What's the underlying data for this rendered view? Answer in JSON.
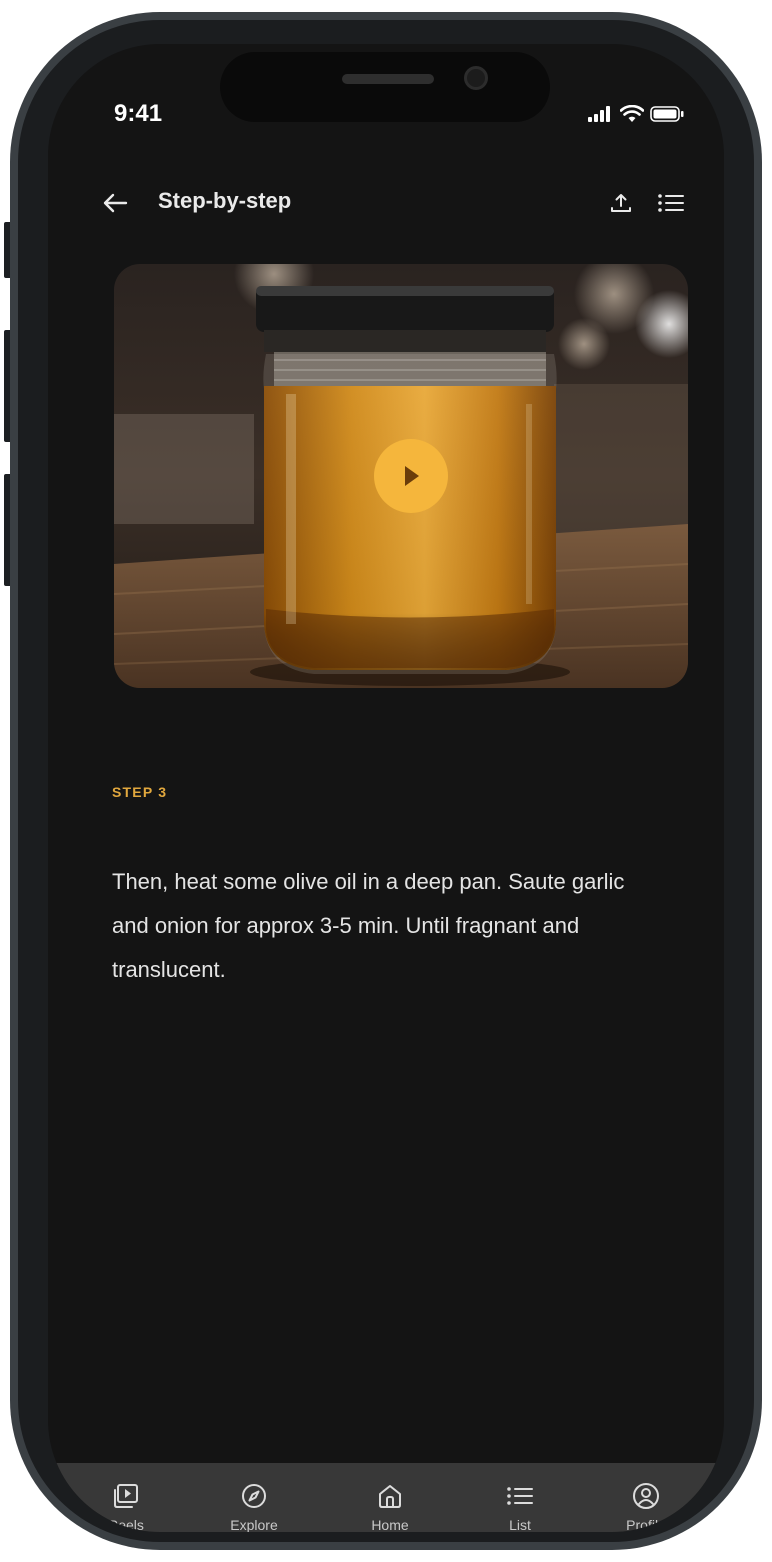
{
  "status_bar": {
    "time": "9:41"
  },
  "header": {
    "title": "Step-by-step"
  },
  "step": {
    "label": "STEP 3",
    "text": "Then, heat some olive oil in a deep pan. Saute garlic and onion for approx 3-5 min. Until fragnant and translucent."
  },
  "nav": {
    "items": [
      {
        "label": "Reels",
        "icon": "reels-icon"
      },
      {
        "label": "Explore",
        "icon": "compass-icon"
      },
      {
        "label": "Home",
        "icon": "home-icon"
      },
      {
        "label": "List",
        "icon": "list-icon"
      },
      {
        "label": "Profile",
        "icon": "profile-icon"
      }
    ]
  },
  "colors": {
    "accent": "#e2a83e",
    "play_button": "#f5b63c",
    "background": "#141414",
    "navbar": "#383838"
  }
}
